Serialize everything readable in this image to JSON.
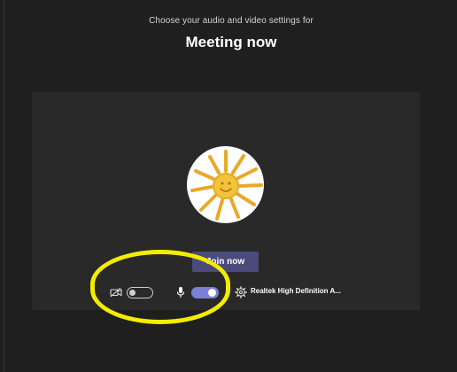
{
  "header": {
    "subtitle": "Choose your audio and video settings for",
    "title": "Meeting now"
  },
  "preview": {
    "avatar_icon": "sun-drawing-icon",
    "join_button_label": "Join now"
  },
  "controls": {
    "camera": {
      "icon": "camera-off-icon",
      "enabled": false
    },
    "microphone": {
      "icon": "microphone-icon",
      "enabled": true
    },
    "device_settings_icon": "gear-icon",
    "audio_device_label": "Realtek High Definition A..."
  },
  "colors": {
    "background": "#1f1f1f",
    "preview_background": "#292929",
    "join_button": "#4a4b7a",
    "toggle_on": "#7b7fd6",
    "highlight": "#f4ec00",
    "sun_yellow": "#e8a929"
  }
}
